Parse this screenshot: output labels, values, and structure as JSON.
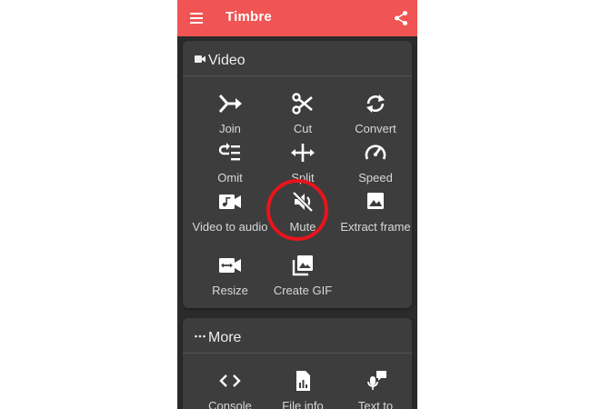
{
  "app": {
    "title": "Timbre",
    "accent_color": "#f05454",
    "menu_icon": "hamburger-menu-icon",
    "share_icon": "share-icon"
  },
  "video_section": {
    "title": "Video",
    "icon": "video-camera-icon",
    "items": [
      {
        "label": "Join",
        "icon": "join-arrow-icon"
      },
      {
        "label": "Cut",
        "icon": "scissors-icon"
      },
      {
        "label": "Convert",
        "icon": "convert-arrows-icon"
      },
      {
        "label": "Omit",
        "icon": "omit-icon"
      },
      {
        "label": "Split",
        "icon": "split-arrows-icon"
      },
      {
        "label": "Speed",
        "icon": "speedometer-icon"
      },
      {
        "label": "Video to audio",
        "icon": "video-to-audio-icon"
      },
      {
        "label": "Mute",
        "icon": "mute-icon"
      },
      {
        "label": "Extract frame",
        "icon": "image-icon"
      },
      {
        "label": "Resize",
        "icon": "resize-icon"
      },
      {
        "label": "Create GIF",
        "icon": "gif-gallery-icon"
      }
    ]
  },
  "more_section": {
    "title": "More",
    "icon": "more-dots-icon",
    "items": [
      {
        "label": "Console",
        "icon": "code-icon"
      },
      {
        "label": "File info",
        "icon": "file-info-icon"
      },
      {
        "label": "Text to",
        "icon": "text-to-speech-icon"
      }
    ]
  },
  "annotation": {
    "highlight_color": "#e8141c",
    "highlighted_item": "Mute"
  }
}
